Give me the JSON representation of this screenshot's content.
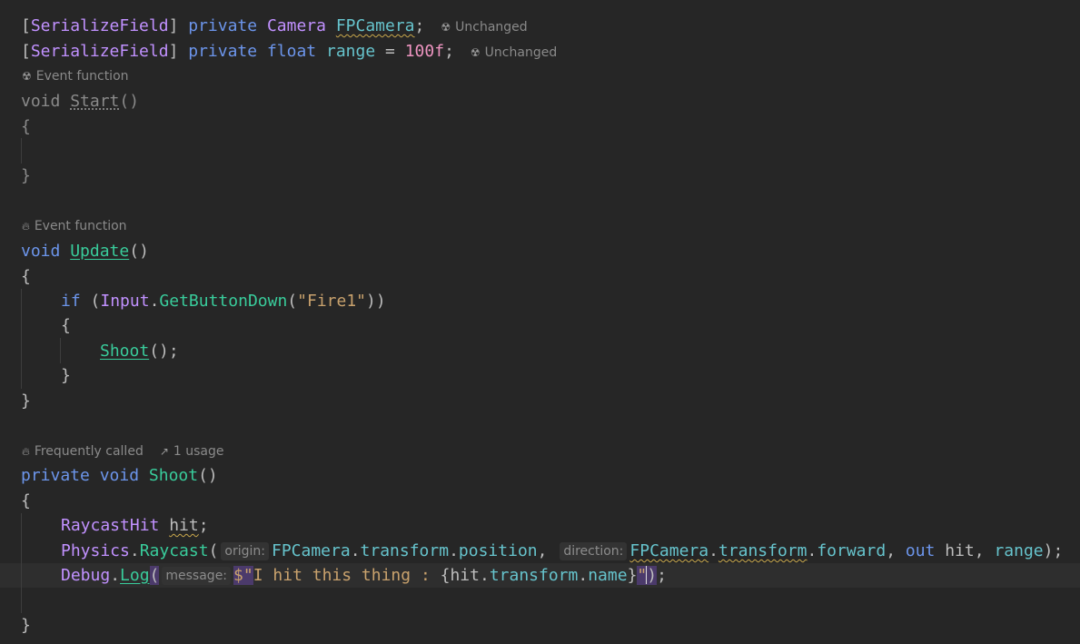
{
  "hints": {
    "unchanged": "Unchanged",
    "event_function": "Event function",
    "frequently_called": "Frequently called",
    "usage": "1 usage"
  },
  "code": {
    "l1": {
      "attr_open": "[",
      "attr": "SerializeField",
      "attr_close": "]",
      "kw": "private",
      "type": "Camera",
      "name": "FPCamera",
      "end": ";"
    },
    "l2": {
      "attr_open": "[",
      "attr": "SerializeField",
      "attr_close": "]",
      "kw1": "private",
      "kw2": "float",
      "name": "range",
      "eq": "=",
      "value": "100f",
      "end": ";"
    },
    "start_sig": {
      "kw": "void",
      "name": "Start",
      "parens": "()"
    },
    "update_sig": {
      "kw": "void",
      "name": "Update",
      "parens": "()"
    },
    "open_brace": "{",
    "close_brace": "}",
    "if_line": {
      "kw": "if",
      "open": "(",
      "cls": "Input",
      "dot": ".",
      "method": "GetButtonDown",
      "paren": "(",
      "arg": "\"Fire1\"",
      "close": "))"
    },
    "shoot_call": {
      "method": "Shoot",
      "tail": "();"
    },
    "shoot_sig": {
      "kw1": "private",
      "kw2": "void",
      "name": "Shoot",
      "parens": "()"
    },
    "raycast_decl": {
      "type": "RaycastHit",
      "name": "hit",
      "end": ";"
    },
    "physics_line": {
      "cls": "Physics",
      "method": "Raycast",
      "open": "(",
      "hint_origin": "origin:",
      "a_obj": "FPCamera",
      "a_f1": "transform",
      "a_f2": "position",
      "comma": ",",
      "hint_direction": "direction:",
      "b_obj": "FPCamera",
      "b_f1": "transform",
      "b_f2": "forward",
      "out_kw": "out",
      "hit": "hit",
      "range": "range",
      "close": ");"
    },
    "debug_line": {
      "cls": "Debug",
      "method": "Log",
      "open": "(",
      "hint_message": "message:",
      "interp": "$\"",
      "text": "I hit this thing : ",
      "brace_open": "{",
      "obj": "hit",
      "f1": "transform",
      "f2": "name",
      "brace_close": "}",
      "quote": "\"",
      "close": ");"
    }
  }
}
